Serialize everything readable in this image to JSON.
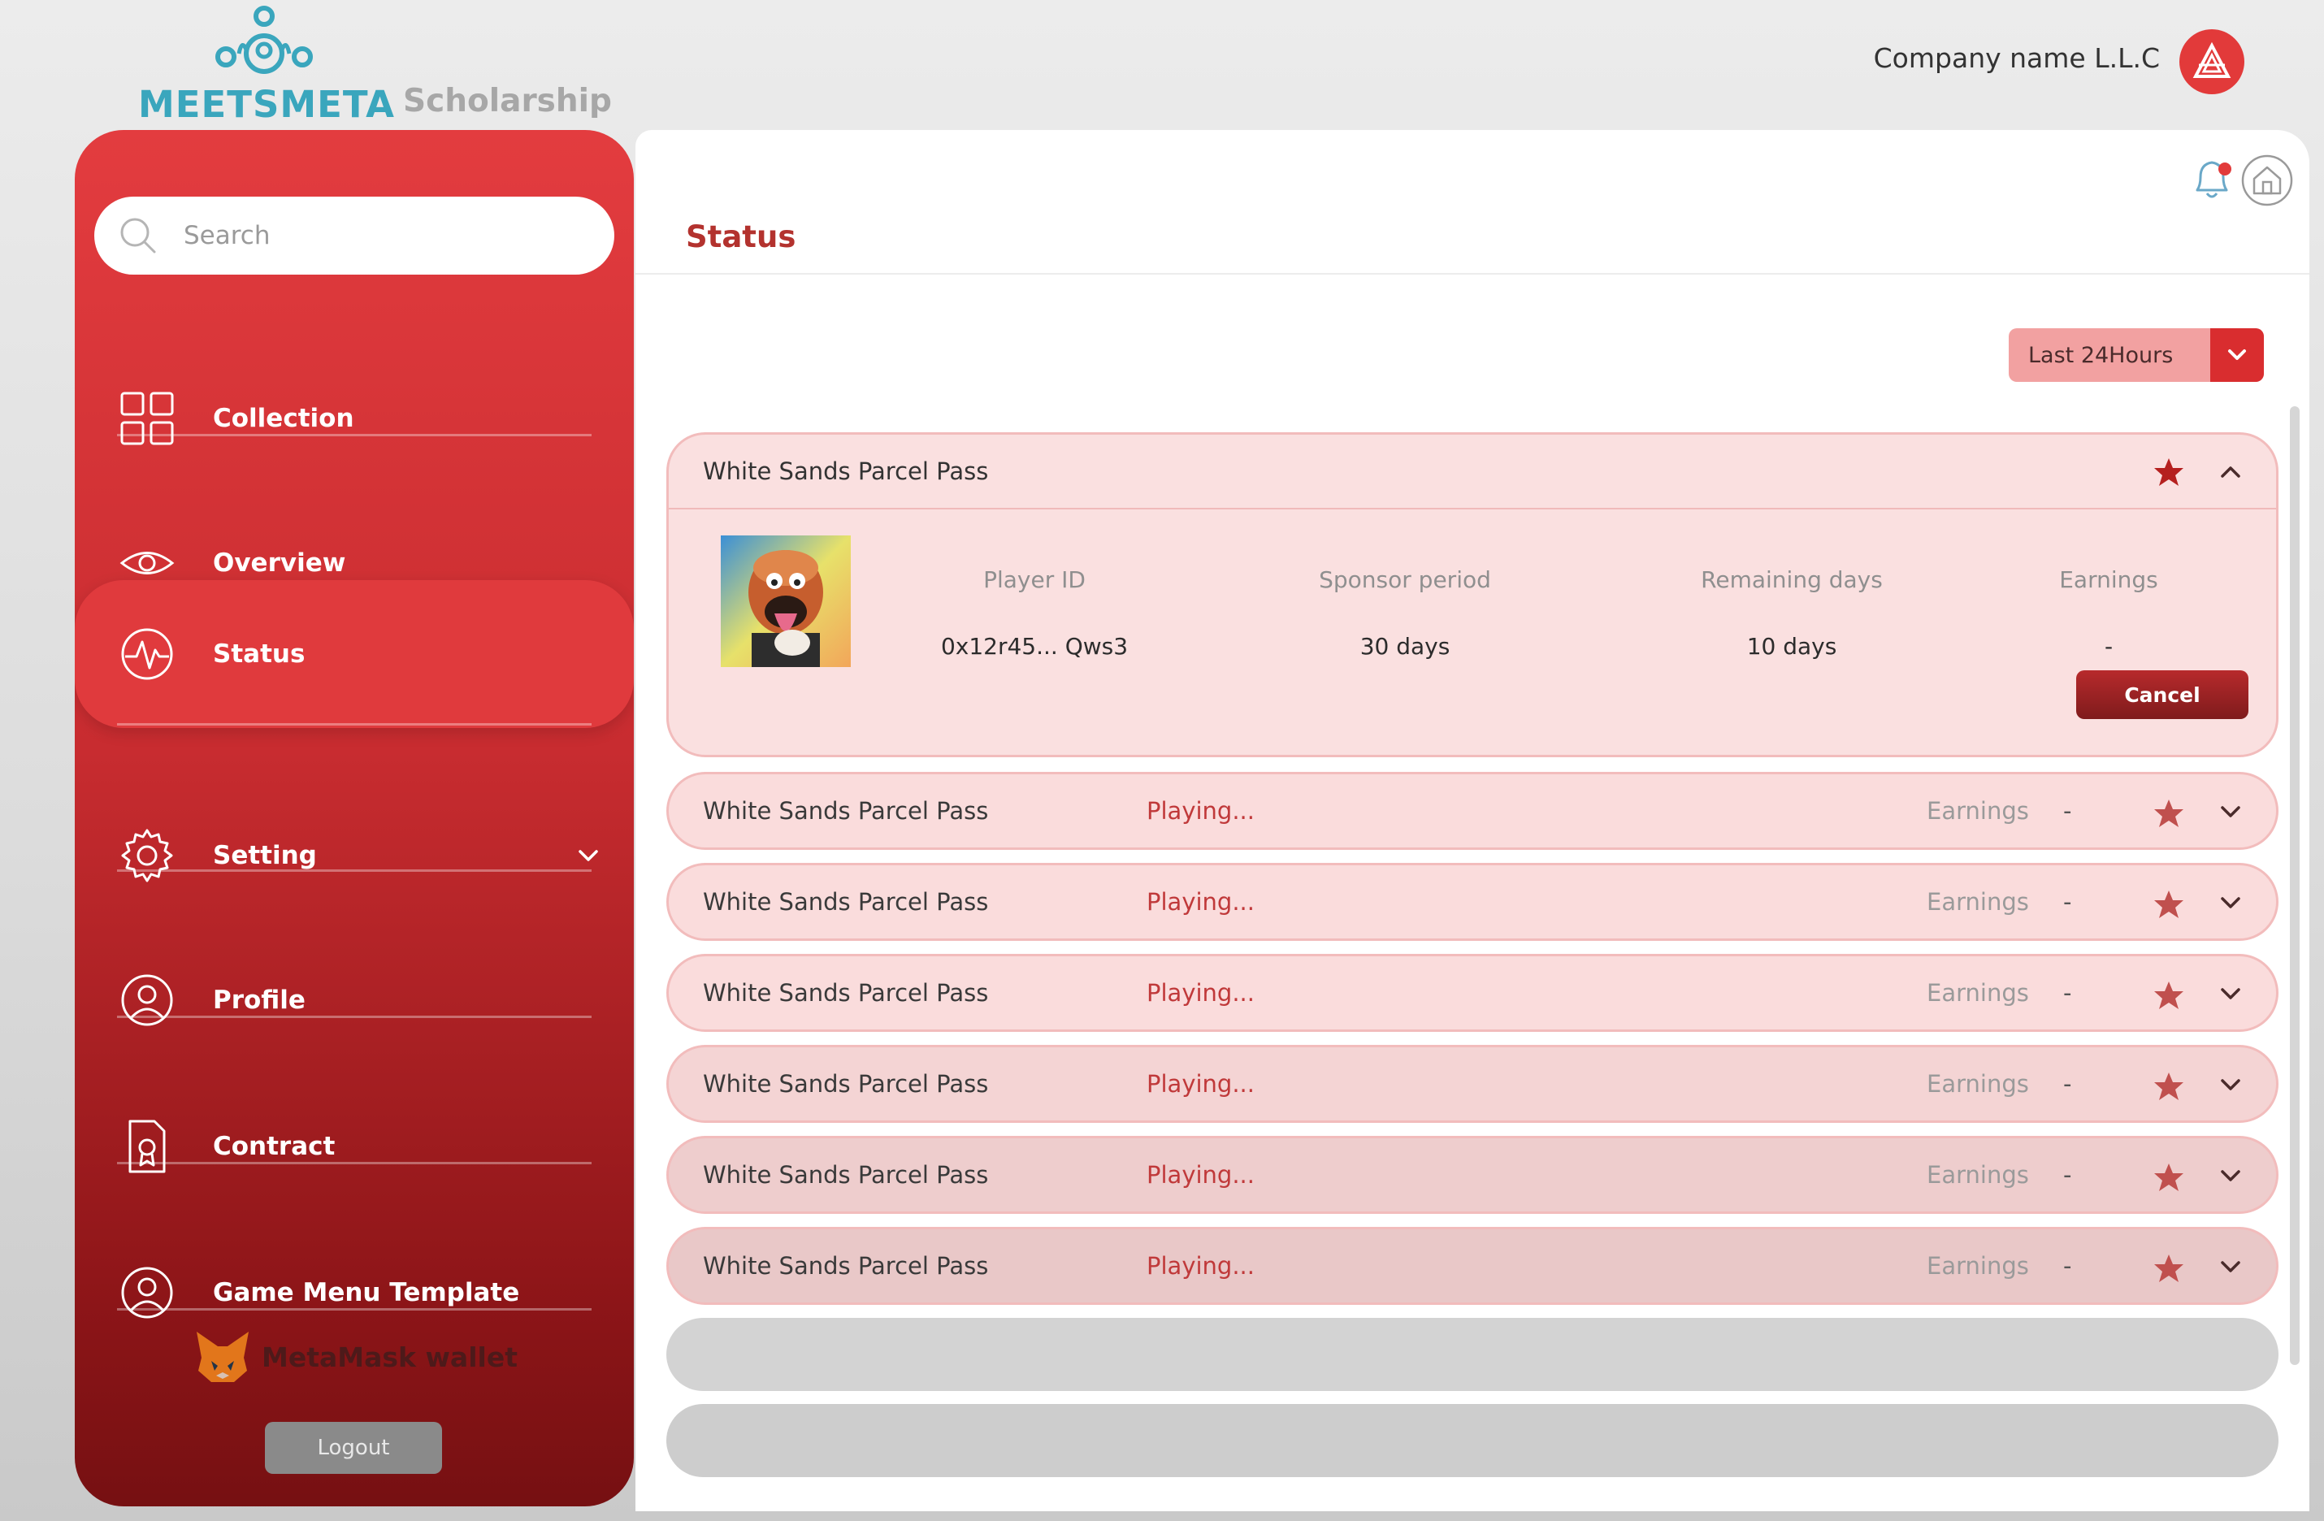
{
  "brand": {
    "logo_icon": "meetsmeta-logo-icon",
    "name": "MEETSMETA",
    "subtitle": "Scholarship",
    "color": "#3aa6bd"
  },
  "header": {
    "company_name": "Company name L.L.C",
    "avatar_icon": "company-logo-icon"
  },
  "sidebar": {
    "search_placeholder": "Search",
    "items": [
      {
        "label": "Collection",
        "icon": "grid-icon"
      },
      {
        "label": "Overview",
        "icon": "eye-icon"
      },
      {
        "label": "Status",
        "icon": "pulse-icon",
        "active": true
      },
      {
        "label": "Setting",
        "icon": "gear-icon",
        "has_submenu": true
      },
      {
        "label": "Profile",
        "icon": "user-circle-icon"
      },
      {
        "label": "Contract",
        "icon": "contract-icon"
      },
      {
        "label": "Game Menu Template",
        "icon": "user-circle-icon"
      }
    ],
    "wallet_label": "MetaMask wallet",
    "logout_label": "Logout"
  },
  "main": {
    "title": "Status",
    "filter": {
      "selected": "Last 24Hours"
    },
    "expanded_card": {
      "title": "White Sands Parcel Pass",
      "favorite": true,
      "columns": [
        {
          "label": "Player ID",
          "value": "0x12r45... Qws3"
        },
        {
          "label": "Sponsor period",
          "value": "30 days"
        },
        {
          "label": "Remaining days",
          "value": "10 days"
        },
        {
          "label": "Earnings",
          "value": "-"
        }
      ],
      "cancel_label": "Cancel"
    },
    "rows": [
      {
        "title": "White Sands Parcel Pass",
        "status": "Playing...",
        "earnings_label": "Earnings",
        "earnings_value": "-"
      },
      {
        "title": "White Sands Parcel Pass",
        "status": "Playing...",
        "earnings_label": "Earnings",
        "earnings_value": "-"
      },
      {
        "title": "White Sands Parcel Pass",
        "status": "Playing...",
        "earnings_label": "Earnings",
        "earnings_value": "-"
      },
      {
        "title": "White Sands Parcel Pass",
        "status": "Playing...",
        "earnings_label": "Earnings",
        "earnings_value": "-"
      },
      {
        "title": "White Sands Parcel Pass",
        "status": "Playing...",
        "earnings_label": "Earnings",
        "earnings_value": "-"
      },
      {
        "title": "White Sands Parcel Pass",
        "status": "Playing...",
        "earnings_label": "Earnings",
        "earnings_value": "-"
      }
    ]
  },
  "colors": {
    "accent": "#e03a3d",
    "title_red": "#b3322e",
    "card_bg": "#fadcdc",
    "status_text": "#c0393a"
  }
}
